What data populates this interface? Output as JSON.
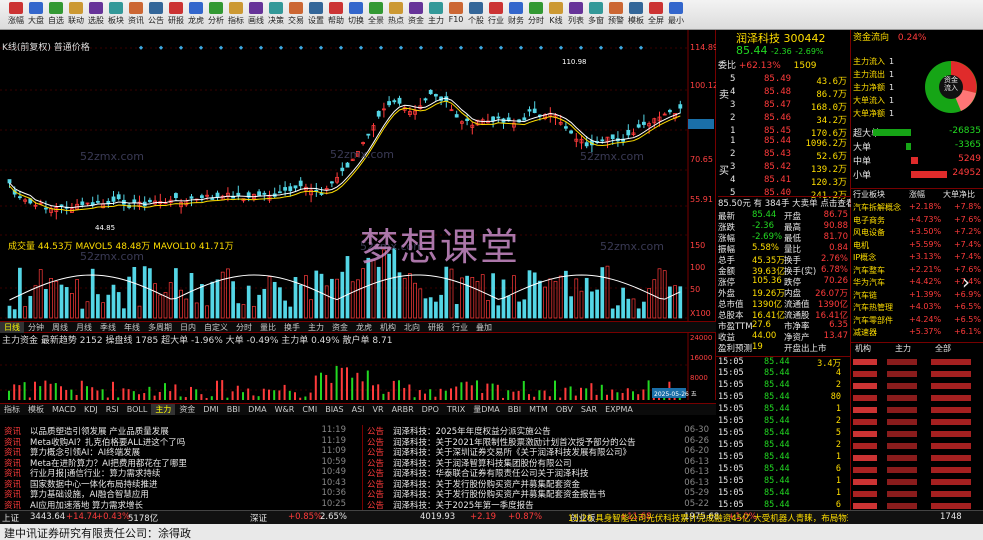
{
  "toolbar": {
    "items": [
      "涨幅",
      "大盘",
      "自选",
      "联动",
      "选股",
      "板块",
      "资讯",
      "公告",
      "研报",
      "龙虎",
      "分析",
      "指标",
      "画线",
      "决策",
      "交易",
      "设置",
      "帮助",
      "切换",
      "全景",
      "热点",
      "资金",
      "主力",
      "F10",
      "个股",
      "行业",
      "财务",
      "分时",
      "K线",
      "列表",
      "多窗",
      "预警",
      "模板",
      "全屏",
      "最小"
    ]
  },
  "chart": {
    "top_label": "K线(前复权) 普通价格",
    "high_label": "110.98",
    "low_label": "44.85",
    "price_axis": [
      "114.89",
      "100.12",
      "85.44",
      "70.65",
      "55.91"
    ],
    "vol_header": "成交量 44.53万 MAVOL5 48.48万 MAVOL10 41.71万",
    "vol_axis": [
      "150",
      "100",
      "50",
      "X100"
    ],
    "sub_header_left": "主力资金 最新趋势 2152 操盘线 1785 超大单 -1.96% 大单 -0.49% 主力单 0.49% 散户单 8.71",
    "sub_axis": [
      "24000",
      "16000",
      "8000"
    ],
    "date_label": "2025-05-26 五",
    "period_tabs": [
      "日线",
      "分钟",
      "周线",
      "月线",
      "季线",
      "年线",
      "多周期",
      "日内",
      "自定义",
      "分时",
      "量比",
      "换手",
      "主力",
      "资金",
      "龙虎",
      "机构",
      "北向",
      "研报",
      "行业",
      "叠加"
    ],
    "indicator_tabs": [
      "指标",
      "模板",
      "MACD",
      "KDJ",
      "RSI",
      "BOLL",
      "主力",
      "资金",
      "DMI",
      "BBI",
      "DMA",
      "W&R",
      "CMI",
      "BIAS",
      "ASI",
      "VR",
      "ARBR",
      "DPO",
      "TRIX",
      "量DMA",
      "BBI",
      "MTM",
      "OBV",
      "SAR",
      "EXPMA"
    ]
  },
  "quote": {
    "name": "润泽科技",
    "code": "300442",
    "price": "85.44",
    "change": "-2.36",
    "change_pct": "-2.69%",
    "weibi_label": "委比",
    "weibi": "+62.13%",
    "weicha": "1509",
    "sell": [
      {
        "lvl": "5",
        "price": "85.49",
        "vol": "43.6万"
      },
      {
        "lvl": "4",
        "price": "85.48",
        "vol": "86.7万"
      },
      {
        "lvl": "3",
        "price": "85.47",
        "vol": "168.0万"
      },
      {
        "lvl": "2",
        "price": "85.46",
        "vol": "34.2万"
      },
      {
        "lvl": "1",
        "price": "85.45",
        "vol": "170.6万"
      }
    ],
    "buy": [
      {
        "lvl": "1",
        "price": "85.44",
        "vol": "1096.2万"
      },
      {
        "lvl": "2",
        "price": "85.43",
        "vol": "52.6万"
      },
      {
        "lvl": "3",
        "price": "85.42",
        "vol": "139.2万"
      },
      {
        "lvl": "4",
        "price": "85.41",
        "vol": "120.3万"
      },
      {
        "lvl": "5",
        "price": "85.40",
        "vol": "241.2万"
      }
    ],
    "sell_side_label": "卖",
    "buy_side_label": "买",
    "summary_line": "85.50元 有 384手 大卖单 点击查看",
    "stats": [
      {
        "k": "最新",
        "v": "85.44",
        "k2": "开盘",
        "v2": "86.75"
      },
      {
        "k": "涨跌",
        "v": "-2.36",
        "k2": "最高",
        "v2": "90.88"
      },
      {
        "k": "涨幅",
        "v": "-2.69%",
        "k2": "最低",
        "v2": "81.70"
      },
      {
        "k": "振幅",
        "v": "5.58%",
        "k2": "量比",
        "v2": "0.84"
      },
      {
        "k": "总手",
        "v": "45.35万",
        "k2": "换手",
        "v2": "2.76%"
      },
      {
        "k": "金额",
        "v": "39.63亿",
        "k2": "换手(实)",
        "v2": "6.78%"
      },
      {
        "k": "涨停",
        "v": "105.36",
        "k2": "跌停",
        "v2": "70.26"
      },
      {
        "k": "外盘",
        "v": "19.26万",
        "k2": "内盘",
        "v2": "26.07万"
      },
      {
        "k": "总市值",
        "v": "1390亿",
        "k2": "流通值",
        "v2": "1390亿"
      },
      {
        "k": "总股本",
        "v": "16.41亿",
        "k2": "流通股",
        "v2": "16.41亿"
      },
      {
        "k": "市盈TTM",
        "v": "27.6",
        "k2": "市净率",
        "v2": "6.35"
      },
      {
        "k": "收益",
        "v": "44.00",
        "k2": "净资产",
        "v2": "13.47"
      },
      {
        "k": "盈利预测",
        "v": "19",
        "k2": "开盘出上市",
        "v2": ""
      }
    ],
    "ticks": [
      {
        "t": "15:05",
        "p": "85.44",
        "v": "3.4万"
      },
      {
        "t": "15:05",
        "p": "85.44",
        "v": "4"
      },
      {
        "t": "15:05",
        "p": "85.44",
        "v": "2"
      },
      {
        "t": "15:05",
        "p": "85.44",
        "v": "80"
      },
      {
        "t": "15:05",
        "p": "85.44",
        "v": "1"
      },
      {
        "t": "15:05",
        "p": "85.44",
        "v": "2"
      },
      {
        "t": "15:05",
        "p": "85.44",
        "v": "5"
      },
      {
        "t": "15:05",
        "p": "85.44",
        "v": "2"
      },
      {
        "t": "15:05",
        "p": "85.44",
        "v": "1"
      },
      {
        "t": "15:05",
        "p": "85.44",
        "v": "6"
      },
      {
        "t": "15:05",
        "p": "85.44",
        "v": "1"
      },
      {
        "t": "15:05",
        "p": "85.44",
        "v": "1"
      },
      {
        "t": "15:05",
        "p": "85.44",
        "v": "6"
      },
      {
        "t": "15:05",
        "p": "85.44",
        "v": "12"
      }
    ]
  },
  "fund": {
    "title": "资金流向",
    "pct": "0.24%",
    "rows": [
      {
        "k": "主力流入",
        "v": "1"
      },
      {
        "k": "主力流出",
        "v": "1"
      },
      {
        "k": "主力净额",
        "v": "1"
      },
      {
        "k": "大单流入",
        "v": "1"
      },
      {
        "k": "大单净额",
        "v": "1"
      }
    ],
    "pie_label_top": "资金",
    "pie_label_bottom": "流入",
    "flows": [
      {
        "k": "超大单",
        "v": "-26835",
        "c": "grn"
      },
      {
        "k": "大单",
        "v": "-3365",
        "c": "grn"
      },
      {
        "k": "中单",
        "v": "5249",
        "c": "red"
      },
      {
        "k": "小单",
        "v": "24952",
        "c": "red"
      }
    ],
    "sector_header": [
      "行业板块",
      "涨幅",
      "大单净比"
    ],
    "sectors": [
      {
        "n": "汽车拆解概念",
        "a": "+2.18%",
        "b": "+7.8%"
      },
      {
        "n": "电子商务",
        "a": "+4.73%",
        "b": "+7.6%"
      },
      {
        "n": "风电设备",
        "a": "+3.50%",
        "b": "+7.2%"
      },
      {
        "n": "电机",
        "a": "+5.59%",
        "b": "+7.4%"
      },
      {
        "n": "IP概念",
        "a": "+3.13%",
        "b": "+7.4%"
      },
      {
        "n": "汽车整车",
        "a": "+2.21%",
        "b": "+7.6%"
      },
      {
        "n": "华为汽车",
        "a": "+4.42%",
        "b": "+7.4%"
      },
      {
        "n": "汽车链",
        "a": "+1.39%",
        "b": "+6.9%"
      },
      {
        "n": "汽车热管理",
        "a": "+4.03%",
        "b": "+6.5%"
      },
      {
        "n": "汽车零部件",
        "a": "+4.24%",
        "b": "+6.5%"
      },
      {
        "n": "减速器",
        "a": "+5.37%",
        "b": "+6.1%"
      }
    ],
    "list_tabs": [
      "机构",
      "主力",
      "全部"
    ]
  },
  "news_left": [
    {
      "tag": "资讯",
      "text": "以品质塑造引领发展 产业品质量发展",
      "time": "11:19"
    },
    {
      "tag": "资讯",
      "text": "Meta收购AI？扎克伯格要ALL进这个了吗",
      "time": "11:19"
    },
    {
      "tag": "资讯",
      "text": "算力概念引领AI：AI终端发展",
      "time": "11:09"
    },
    {
      "tag": "资讯",
      "text": "Meta在进阶算力？AI把费用都花在了哪里",
      "time": "10:59"
    },
    {
      "tag": "资讯",
      "text": "行业月报|通信行业：算力需求持续",
      "time": "10:49"
    },
    {
      "tag": "资讯",
      "text": "国家数据中心一体化布局持续推进",
      "time": "10:43"
    },
    {
      "tag": "资讯",
      "text": "算力基础设施，AI融合智慧应用",
      "time": "10:36"
    },
    {
      "tag": "资讯",
      "text": "AI应用加速落地 算力需求增长",
      "time": "10:25"
    }
  ],
  "news_right": [
    {
      "tag": "公告",
      "text": "润泽科技：2025年年度权益分派实施公告",
      "time": "06-30"
    },
    {
      "tag": "公告",
      "text": "润泽科技：关于2021年限制性股票激励计划首次授予部分的公告",
      "time": "06-26"
    },
    {
      "tag": "公告",
      "text": "润泽科技：关于深圳证券交易所《关于润泽科技发展有限公司》",
      "time": "06-20"
    },
    {
      "tag": "公告",
      "text": "润泽科技：关于润泽智算科技集团股份有限公司",
      "time": "06-13"
    },
    {
      "tag": "公告",
      "text": "润泽科技：华泰联合证券有限责任公司关于润泽科技",
      "time": "06-13"
    },
    {
      "tag": "公告",
      "text": "润泽科技：关于发行股份购买资产并募集配套资金",
      "time": "06-13"
    },
    {
      "tag": "公告",
      "text": "润泽科技：关于发行股份购买资产并募集配套资金报告书",
      "time": "05-29"
    },
    {
      "tag": "公告",
      "text": "润泽科技：关于2025年第一季度报告",
      "time": "05-22"
    }
  ],
  "statusbar": {
    "items": [
      "上证",
      "3443.64",
      "+14.74",
      "+0.43%",
      "5178亿",
      "深证",
      "+0.85%",
      "2.65%",
      "4019.93",
      "+2.19",
      "+0.87%",
      "创业板",
      "+11.68",
      "1975.68",
      "+1.0%",
      "1748"
    ],
    "ticker": "15:26 具身智能公司光伏科技累计完成融资45亿 大受机器人青睐，布局物理AI上线正式盘"
  },
  "caption": "建中讯证券研究有限责任公司：涂得政",
  "watermark": {
    "big": "梦想课堂",
    "site": "52zmx.com"
  }
}
